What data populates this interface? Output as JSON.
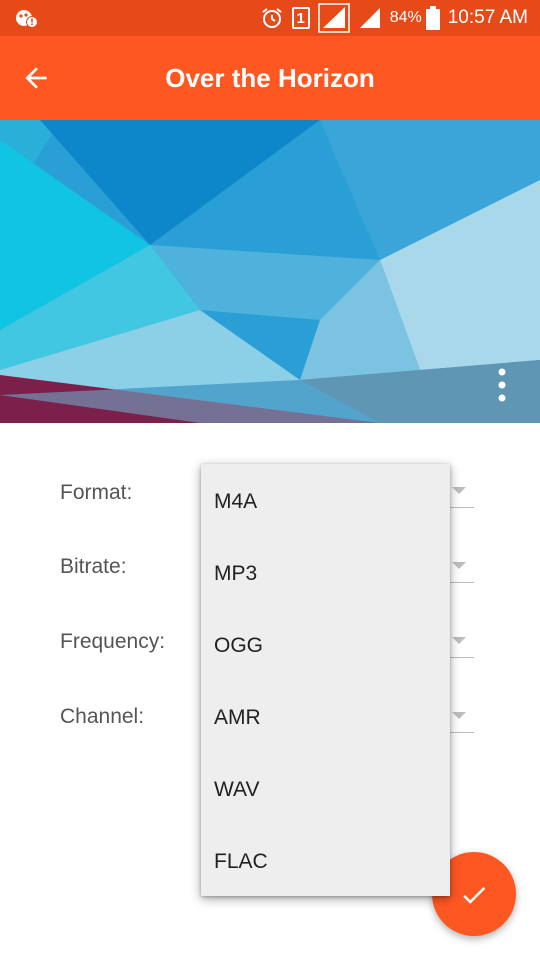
{
  "status_bar": {
    "battery_percent": "84%",
    "time": "10:57 AM",
    "sim_slot": "1"
  },
  "app_bar": {
    "title": "Over the Horizon",
    "back_icon": "arrow-back-icon"
  },
  "header": {
    "more_icon": "more-vert-icon"
  },
  "form": {
    "format_label": "Format:",
    "bitrate_label": "Bitrate:",
    "frequency_label": "Frequency:",
    "channel_label": "Channel:"
  },
  "dropdown": {
    "options": [
      "M4A",
      "MP3",
      "OGG",
      "AMR",
      "WAV",
      "FLAC"
    ]
  },
  "fab": {
    "icon": "check-icon"
  },
  "colors": {
    "status_bar": "#e64a19",
    "accent": "#ff5722",
    "dropdown_bg": "#eeeeee"
  }
}
